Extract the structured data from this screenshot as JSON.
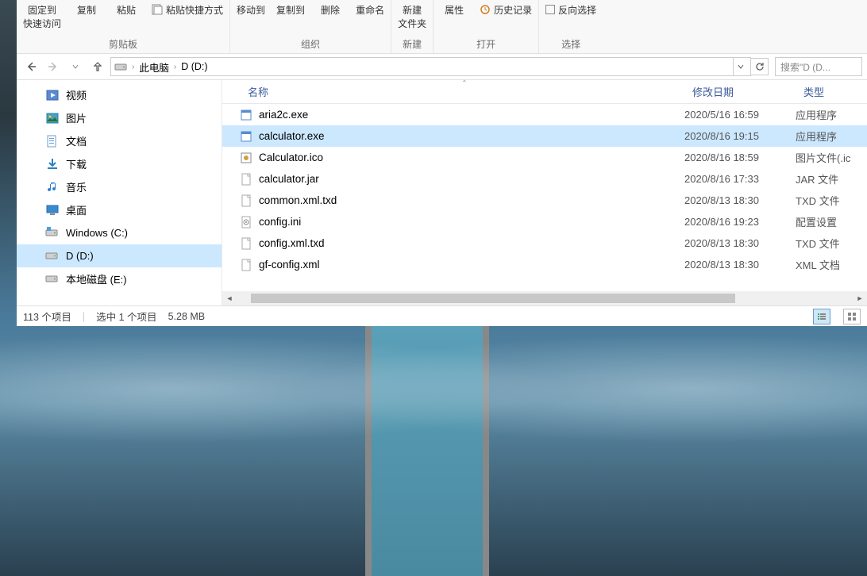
{
  "ribbon": {
    "groups": [
      {
        "label": "剪贴板",
        "items": [
          {
            "label": "固定到\n快速访问",
            "big": true,
            "disabled": false
          },
          {
            "label": "复制",
            "big": true,
            "disabled": false
          },
          {
            "label": "粘贴",
            "big": true,
            "disabled": false
          }
        ],
        "mini": [
          "粘贴快捷方式"
        ]
      },
      {
        "label": "组织",
        "items": [
          {
            "label": "移动到",
            "disabled": false
          },
          {
            "label": "复制到",
            "disabled": false
          },
          {
            "label": "删除",
            "disabled": false
          },
          {
            "label": "重命名",
            "disabled": false
          }
        ]
      },
      {
        "label": "新建",
        "items": [
          {
            "label": "新建\n文件夹"
          }
        ]
      },
      {
        "label": "打开",
        "items": [
          {
            "label": "属性"
          }
        ],
        "mini": [
          "历史记录"
        ]
      },
      {
        "label": "选择",
        "mini_check": [
          "反向选择"
        ]
      }
    ]
  },
  "address": {
    "parts": [
      "此电脑",
      "D (D:)"
    ]
  },
  "search_placeholder": "搜索\"D (D...",
  "sidebar": [
    {
      "label": "视频",
      "icon": "video"
    },
    {
      "label": "图片",
      "icon": "pictures"
    },
    {
      "label": "文档",
      "icon": "documents"
    },
    {
      "label": "下载",
      "icon": "downloads"
    },
    {
      "label": "音乐",
      "icon": "music"
    },
    {
      "label": "桌面",
      "icon": "desktop"
    },
    {
      "label": "Windows (C:)",
      "icon": "drive-win"
    },
    {
      "label": "D (D:)",
      "icon": "drive",
      "selected": true
    },
    {
      "label": "本地磁盘 (E:)",
      "icon": "drive"
    }
  ],
  "columns": {
    "name": "名称",
    "date": "修改日期",
    "type": "类型"
  },
  "files": [
    {
      "name": "aria2c.exe",
      "date": "2020/5/16 16:59",
      "type": "应用程序",
      "icon": "exe"
    },
    {
      "name": "calculator.exe",
      "date": "2020/8/16 19:15",
      "type": "应用程序",
      "icon": "exe",
      "selected": true
    },
    {
      "name": "Calculator.ico",
      "date": "2020/8/16 18:59",
      "type": "图片文件(.ic",
      "icon": "ico"
    },
    {
      "name": "calculator.jar",
      "date": "2020/8/16 17:33",
      "type": "JAR 文件",
      "icon": "blank"
    },
    {
      "name": "common.xml.txd",
      "date": "2020/8/13 18:30",
      "type": "TXD 文件",
      "icon": "blank"
    },
    {
      "name": "config.ini",
      "date": "2020/8/16 19:23",
      "type": "配置设置",
      "icon": "ini"
    },
    {
      "name": "config.xml.txd",
      "date": "2020/8/13 18:30",
      "type": "TXD 文件",
      "icon": "blank"
    },
    {
      "name": "gf-config.xml",
      "date": "2020/8/13 18:30",
      "type": "XML 文档",
      "icon": "blank"
    }
  ],
  "status": {
    "items": "113 个项目",
    "selected": "选中 1 个项目",
    "size": "5.28 MB"
  }
}
